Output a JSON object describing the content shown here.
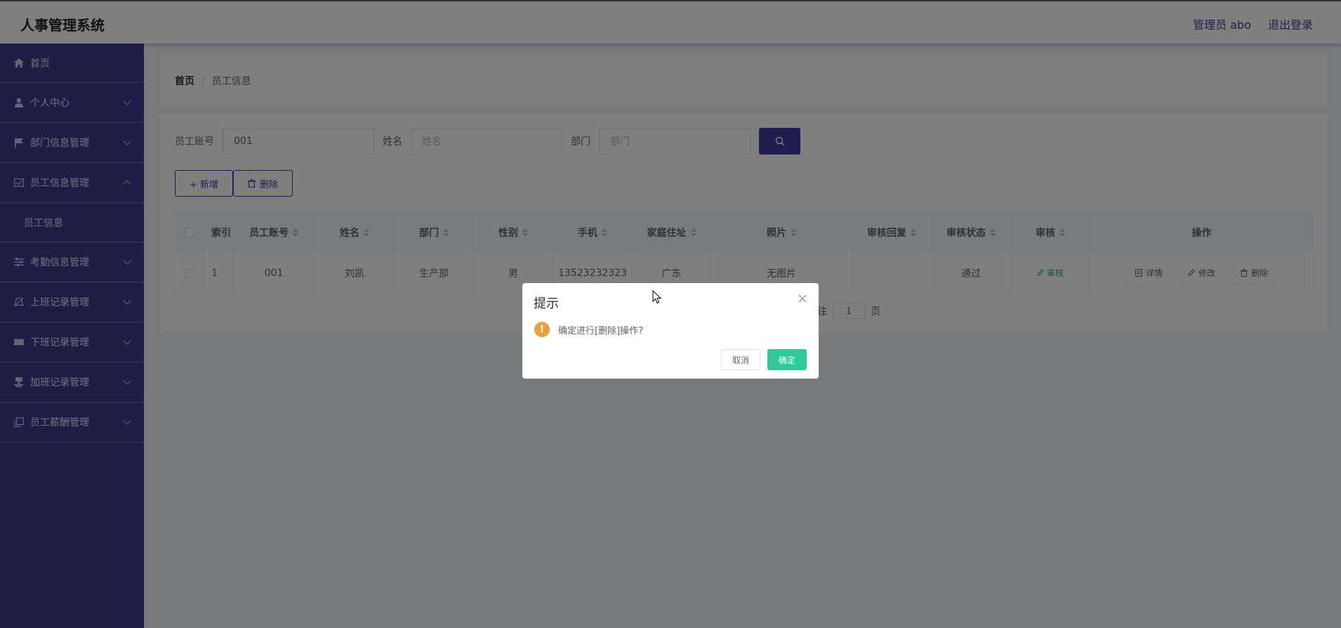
{
  "header": {
    "title": "人事管理系统",
    "user_label": "管理员 abo",
    "logout_label": "退出登录"
  },
  "sidebar": {
    "items": [
      {
        "label": "首页",
        "icon": "home-icon"
      },
      {
        "label": "个人中心",
        "icon": "user-icon"
      },
      {
        "label": "部门信息管理",
        "icon": "flag-icon"
      },
      {
        "label": "员工信息管理",
        "icon": "card-icon",
        "expanded": true,
        "children": [
          {
            "label": "员工信息"
          }
        ]
      },
      {
        "label": "考勤信息管理",
        "icon": "sliders-icon"
      },
      {
        "label": "上班记录管理",
        "icon": "bell-icon"
      },
      {
        "label": "下班记录管理",
        "icon": "ticket-icon"
      },
      {
        "label": "加班记录管理",
        "icon": "stamp-icon"
      },
      {
        "label": "员工薪酬管理",
        "icon": "copy-icon"
      }
    ]
  },
  "breadcrumb": {
    "home": "首页",
    "sep": "/",
    "current": "员工信息"
  },
  "search": {
    "account_label": "员工账号",
    "account_value": "001",
    "name_label": "姓名",
    "name_placeholder": "姓名",
    "dept_label": "部门",
    "dept_placeholder": "部门"
  },
  "toolbar": {
    "add_label": "+ 新增",
    "delete_label": "删除"
  },
  "table": {
    "headers": [
      "索引",
      "员工账号",
      "姓名",
      "部门",
      "性别",
      "手机",
      "家庭住址",
      "照片",
      "审核回复",
      "审核状态",
      "审核",
      "操作"
    ],
    "rows": [
      {
        "index": "1",
        "account": "001",
        "name": "刘凯",
        "dept": "生产部",
        "gender": "男",
        "phone": "13523232323",
        "address": "广东",
        "photo": "无图片",
        "reply": "",
        "status": "通过",
        "audit": "审核",
        "actions": [
          "详情",
          "修改",
          "删除"
        ]
      }
    ]
  },
  "pager": {
    "goto_prefix": "往",
    "page": "1",
    "suffix": "页"
  },
  "dialog": {
    "title": "提示",
    "message": "确定进行[删除]操作?",
    "cancel": "取消",
    "confirm": "确定",
    "warn_glyph": "!"
  },
  "colors": {
    "sidebar": "#3b3b8c",
    "accent": "#3b3b9c",
    "confirm": "#2fc99a",
    "warning": "#e6a23c",
    "audit_link": "#1fa974"
  }
}
